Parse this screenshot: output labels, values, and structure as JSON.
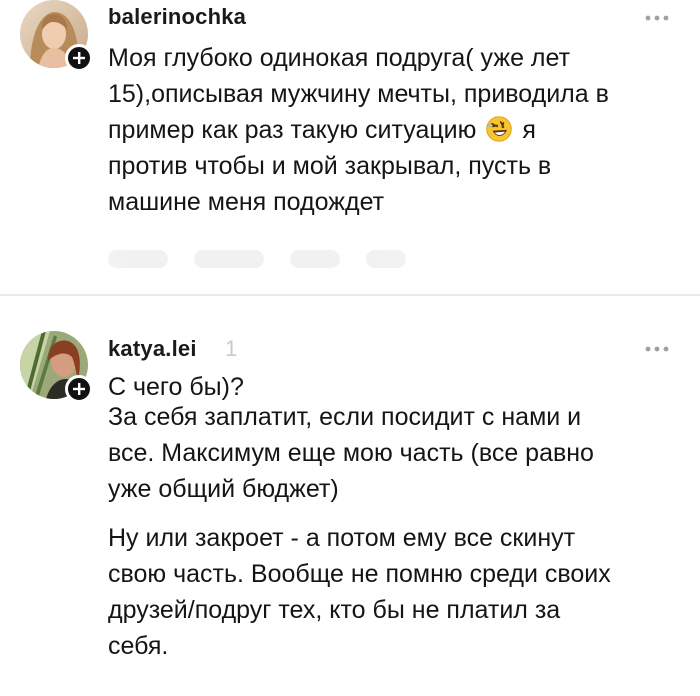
{
  "comments": [
    {
      "username": "balerinochka",
      "handle_suffix": "",
      "text_paragraphs": [
        "Моя глубоко одинокая подруга( уже лет\n15),описывая мужчину мечты, приводила в\nпример как раз такую ситуацию",
        "я\nпротив чтобы и мой закрывал, пусть в\nмашине меня подождет"
      ],
      "emoji": "rolling-on-the-floor-laughing-emoji"
    },
    {
      "username": "katya.lei",
      "handle_suffix": "1",
      "text_paragraphs": [
        "С чего бы)?",
        "За себя заплатит, если посидит с нами и\nвсе. Максимум еще мою часть (все равно\nуже общий бюджет)",
        "Ну или закроет - а потом ему все скинут\nсвою часть. Вообще не помню среди своих\nдрузей/подруг тех, кто бы не платил за\nсебя."
      ]
    }
  ],
  "icons": {
    "more": "more-horizontal-icon",
    "follow": "plus-circle-icon"
  },
  "colors": {
    "text": "#151515",
    "muted": "#c9c9c9",
    "badge": "#111111",
    "divider": "#e9e9e9"
  }
}
